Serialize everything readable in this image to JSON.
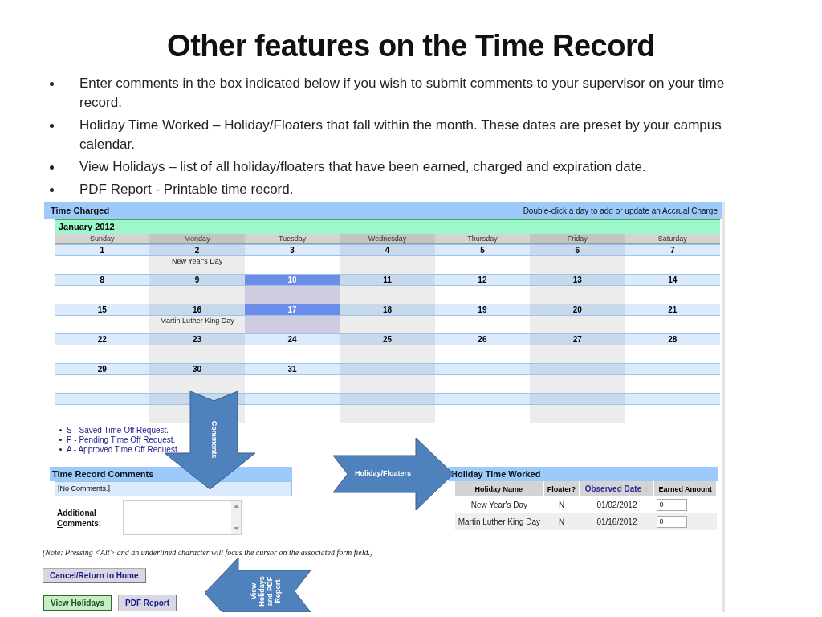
{
  "slide": {
    "title": "Other features on the Time Record",
    "bullets": [
      "Enter comments in the box indicated below if you wish to submit comments to your supervisor on your time record.",
      "Holiday Time Worked – Holiday/Floaters that fall within the month.  These dates are preset by your campus calendar.",
      "View Holidays – list of all holiday/floaters that have been earned, charged and expiration date.",
      "PDF  Report -  Printable time record."
    ]
  },
  "time_charged": {
    "title": "Time Charged",
    "hint": "Double-click a day to add or update an Accrual Charge",
    "month": "January 2012",
    "weekdays": [
      "Sunday",
      "Monday",
      "Tuesday",
      "Wednesday",
      "Thursday",
      "Friday",
      "Saturday"
    ],
    "weeks": [
      [
        {
          "day": "1",
          "selected": false
        },
        {
          "day": "2",
          "selected": false,
          "note": "New Year's Day"
        },
        {
          "day": "3",
          "selected": false
        },
        {
          "day": "4",
          "selected": false
        },
        {
          "day": "5",
          "selected": false
        },
        {
          "day": "6",
          "selected": false
        },
        {
          "day": "7",
          "selected": false
        }
      ],
      [
        {
          "day": "8",
          "selected": false
        },
        {
          "day": "9",
          "selected": false
        },
        {
          "day": "10",
          "selected": true
        },
        {
          "day": "11",
          "selected": false
        },
        {
          "day": "12",
          "selected": false
        },
        {
          "day": "13",
          "selected": false
        },
        {
          "day": "14",
          "selected": false
        }
      ],
      [
        {
          "day": "15",
          "selected": false
        },
        {
          "day": "16",
          "selected": false,
          "note": "Martin Luther King Day"
        },
        {
          "day": "17",
          "selected": true
        },
        {
          "day": "18",
          "selected": false
        },
        {
          "day": "19",
          "selected": false
        },
        {
          "day": "20",
          "selected": false
        },
        {
          "day": "21",
          "selected": false
        }
      ],
      [
        {
          "day": "22",
          "selected": false
        },
        {
          "day": "23",
          "selected": false
        },
        {
          "day": "24",
          "selected": false
        },
        {
          "day": "25",
          "selected": false
        },
        {
          "day": "26",
          "selected": false
        },
        {
          "day": "27",
          "selected": false
        },
        {
          "day": "28",
          "selected": false
        }
      ],
      [
        {
          "day": "29",
          "selected": false
        },
        {
          "day": "30",
          "selected": false
        },
        {
          "day": "31",
          "selected": false
        }
      ]
    ]
  },
  "legend": [
    "S - Saved Time Off Request.",
    "P - Pending Time Off Request.",
    "A - Approved Time Off Request."
  ],
  "comments": {
    "title": "Time Record Comments",
    "existing": "[No Comments.]",
    "label_lines": [
      "Additional",
      "Comments:"
    ],
    "access_key_underlined": true
  },
  "holiday_time_worked": {
    "title": "Holiday Time Worked",
    "columns": [
      {
        "label": "Holiday Name",
        "sortable": false
      },
      {
        "label": "Floater?",
        "sortable": false
      },
      {
        "label": "Observed Date",
        "sortable": true
      },
      {
        "label": "Earned Amount",
        "sortable": false
      }
    ],
    "rows": [
      {
        "name": "New Year's Day",
        "floater": "N",
        "observed_date": "01/02/2012",
        "earned_amount": "0"
      },
      {
        "name": "Martin Luther King Day",
        "floater": "N",
        "observed_date": "01/16/2012",
        "earned_amount": "0"
      }
    ]
  },
  "note": "(Note: Pressing <Alt> and an underlined character will focus the cursor on the associated form field.)",
  "button_rows": [
    [
      {
        "label": "Cancel/Return to Home",
        "kind": "plain"
      }
    ],
    [
      {
        "label": "View Holidays",
        "kind": "highlighted"
      },
      {
        "label": "PDF Report",
        "kind": "plain"
      }
    ]
  ],
  "callouts": [
    {
      "kind": "down",
      "lines": [
        "Comments"
      ]
    },
    {
      "kind": "right",
      "lines": [
        "Holiday/Floaters"
      ]
    },
    {
      "kind": "left",
      "lines": [
        "View",
        "Holidays",
        "and PDF",
        "Report"
      ]
    }
  ]
}
